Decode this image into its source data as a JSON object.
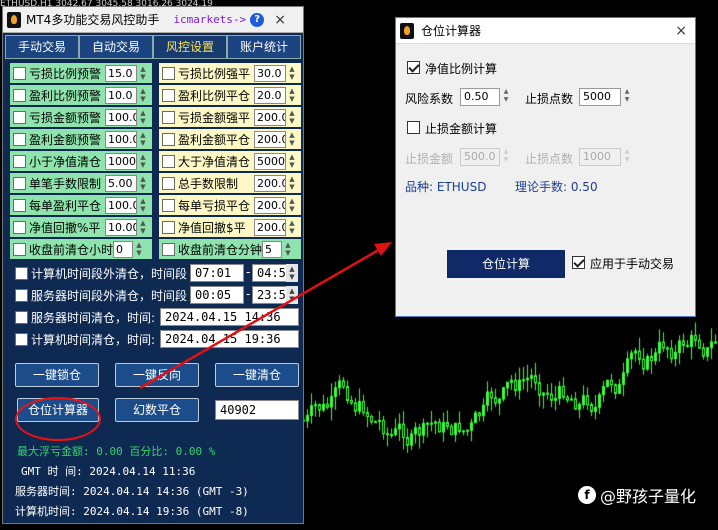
{
  "chart_header": "ETHUSD,H1  3042.67 3045.58 3016.26 3024.19",
  "panel": {
    "title": "MT4多功能交易风控助手",
    "broker": "icmarkets->",
    "help": "?",
    "close": "×",
    "tabs": [
      "手动交易",
      "自动交易",
      "风控设置",
      "账户统计"
    ],
    "active_tab": 2,
    "settings_rows": [
      {
        "left": {
          "label": "亏损比例预警",
          "value": "15.0"
        },
        "right": {
          "label": "亏损比例强平",
          "value": "30.0"
        }
      },
      {
        "left": {
          "label": "盈利比例预警",
          "value": "10.0"
        },
        "right": {
          "label": "盈利比例平仓",
          "value": "20.0"
        }
      },
      {
        "left": {
          "label": "亏损金额预警",
          "value": "100.0"
        },
        "right": {
          "label": "亏损金额强平",
          "value": "200.0"
        }
      },
      {
        "left": {
          "label": "盈利金额预警",
          "value": "100.0"
        },
        "right": {
          "label": "盈利金额平仓",
          "value": "200.0"
        }
      },
      {
        "left": {
          "label": "小于净值清仓",
          "value": "10000"
        },
        "right": {
          "label": "大于净值清仓",
          "value": "50000"
        }
      },
      {
        "left": {
          "label": "单笔手数限制",
          "value": "5.00"
        },
        "right": {
          "label": "总手数限制",
          "value": "200.00"
        }
      },
      {
        "left": {
          "label": "每单盈利平仓",
          "value": "100.0"
        },
        "right": {
          "label": "每单亏损平仓",
          "value": "200.0"
        }
      },
      {
        "left": {
          "label": "净值回撤%平",
          "value": "10.00"
        },
        "right": {
          "label": "净值回撤$平",
          "value": "200.0"
        }
      },
      {
        "left": {
          "label": "收盘前清仓小时",
          "value": "0"
        },
        "right": {
          "label": "收盘前清仓分钟",
          "value": "5"
        }
      }
    ],
    "time_rows": [
      {
        "label": "计算机时间段外清仓，时间段",
        "from": "07:01",
        "to": "04:55"
      },
      {
        "label": "服务器时间段外清仓，时间段",
        "from": "00:05",
        "to": "23:55"
      }
    ],
    "datetime_rows": [
      {
        "label": "服务器时间清仓，时间:",
        "value": "2024.04.15 14:36"
      },
      {
        "label": "计算机时间清仓，时间:",
        "value": "2024.04.15 19:36"
      }
    ],
    "buttons": {
      "lock": "一键锁仓",
      "reverse": "一键反向",
      "close_all": "一键清仓",
      "calc": "仓位计算器",
      "magic_close": "幻数平仓",
      "magic_value": "40902"
    },
    "stats": {
      "max_float": "最大浮亏金额:  0.00 百分比: 0.00 %",
      "gmt": "GMT 时 间: 2024.04.14 11:36",
      "server": "服务器时间: 2024.04.14 14:36 (GMT -3)",
      "local": "计算机时间: 2024.04.14 19:36 (GMT -8)"
    }
  },
  "calculator": {
    "title": "仓位计算器",
    "close": "×",
    "equity_ratio_label": "净值比例计算",
    "risk_label": "风险系数",
    "risk_value": "0.50",
    "sl_points_label": "止损点数",
    "sl_points_value": "5000",
    "sl_amount_mode_label": "止损金额计算",
    "sl_amount_label": "止损金额",
    "sl_amount_value": "500.0",
    "sl_points2_label": "止损点数",
    "sl_points2_value": "1000",
    "symbol_text": "品种:  ETHUSD",
    "lots_text": "理论手数: 0.50",
    "calc_button": "仓位计算",
    "apply_label": "应用于手动交易"
  },
  "watermark": "@野孩子量化",
  "colors": {
    "panel_bg": "#0f2a52",
    "green_cell": "#8fe3ad",
    "yellow_cell": "#fdf8c6",
    "dialog_button": "#0f2a66",
    "annotation": "#e11111"
  }
}
